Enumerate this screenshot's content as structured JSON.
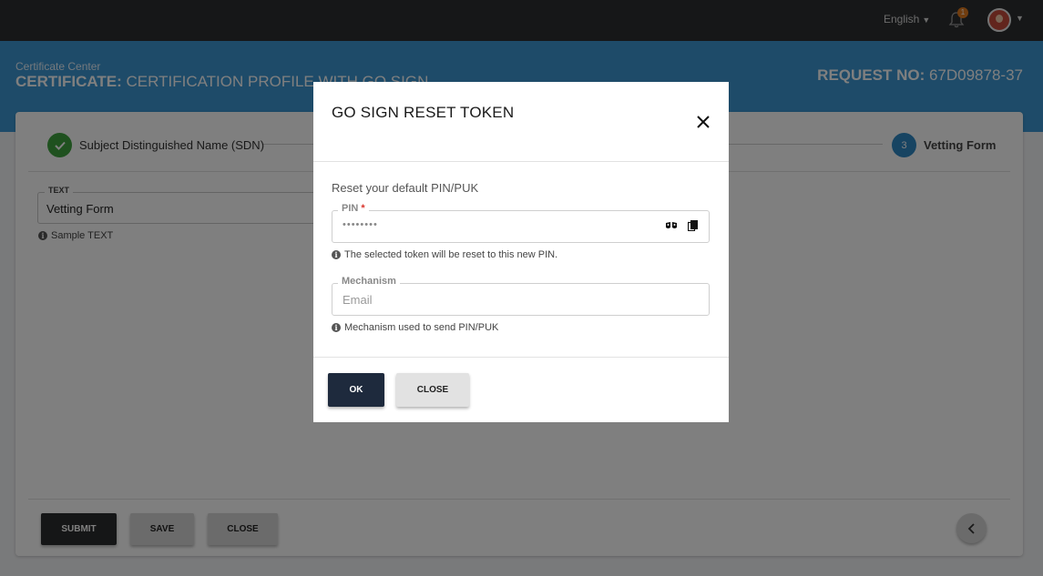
{
  "topbar": {
    "language": "English",
    "notification_count": "1"
  },
  "header": {
    "breadcrumb": "Certificate Center",
    "title_prefix": "CERTIFICATE:",
    "title_text": " CERTIFICATION PROFILE WITH GO SIGN",
    "request_prefix": "REQUEST NO:",
    "request_value": " 67D09878-37"
  },
  "stepper": {
    "step1_label": "Subject Distinguished Name (SDN)",
    "step3_number": "3",
    "step3_label": "Vetting Form"
  },
  "form": {
    "text_label": "TEXT",
    "text_value": "Vetting Form",
    "text_hint": "Sample TEXT"
  },
  "footer": {
    "submit_label": "SUBMIT",
    "save_label": "SAVE",
    "close_label": "CLOSE"
  },
  "modal": {
    "title": "GO SIGN RESET TOKEN",
    "subtitle": "Reset your default PIN/PUK",
    "pin_label": "PIN",
    "pin_required_mark": "*",
    "pin_value": "••••••••",
    "pin_hint": "The selected token will be reset to this new PIN.",
    "mechanism_label": "Mechanism",
    "mechanism_value": "Email",
    "mechanism_hint": "Mechanism used to send PIN/PUK",
    "ok_label": "OK",
    "close_label": "CLOSE"
  },
  "colors": {
    "topbar": "#2d2e30",
    "header": "#3c97d2",
    "step_done": "#3fa33f",
    "step_active": "#2f88c5",
    "ok_button": "#1e2a3d"
  },
  "icons": [
    "chevron-down-icon",
    "bell-icon",
    "avatar",
    "check-icon",
    "info-icon",
    "close-icon",
    "eye-icon",
    "copy-icon",
    "chevron-left-icon"
  ]
}
